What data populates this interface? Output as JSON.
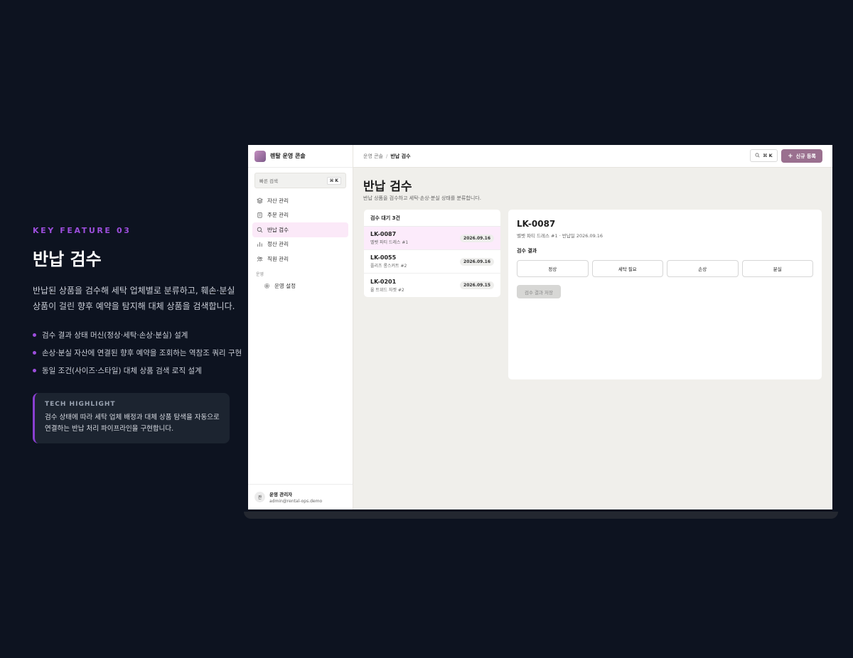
{
  "feature": {
    "eyebrow": "KEY FEATURE 03",
    "title": "반납 검수",
    "description": "반납된 상품을 검수해 세탁 업체별로 분류하고, 훼손·분실 상품이 걸린 향후 예약을 탐지해 대체 상품을 검색합니다.",
    "bullets": [
      "검수 결과 상태 머신(정상·세탁·손상·분실) 설계",
      "손상·분실 자산에 연결된 향후 예약을 조회하는 역참조 쿼리 구현",
      "동일 조건(사이즈·스타일) 대체 상품 검색 로직 설계"
    ],
    "tech_label": "TECH HIGHLIGHT",
    "tech_text": "검수 상태에 따라 세탁 업체 배정과 대체 상품 탐색을 자동으로 연결하는 반납 처리 파이프라인을 구현합니다.",
    "accent_color": "#9d4edd"
  },
  "app": {
    "brand": "렌탈 운영 콘솔",
    "quick_search_label": "빠른 검색",
    "quick_search_shortcut": "⌘ K",
    "nav": [
      {
        "label": "자산 관리",
        "icon": "layers-icon",
        "active": false
      },
      {
        "label": "주문 관리",
        "icon": "clipboard-icon",
        "active": false
      },
      {
        "label": "반납 검수",
        "icon": "search-icon",
        "active": true
      },
      {
        "label": "정산 관리",
        "icon": "bar-chart-icon",
        "active": false
      },
      {
        "label": "직원 관리",
        "icon": "users-icon",
        "active": false
      }
    ],
    "nav_section": "운영",
    "settings_label": "운영 설정",
    "user": {
      "avatar": "관",
      "name": "운영 관리자",
      "email": "admin@rental-ops.demo"
    },
    "breadcrumb": {
      "root": "운영 콘솔",
      "separator": "/",
      "current": "반납 검수"
    },
    "top_search_shortcut": "⌘ K",
    "new_button": "신규 등록",
    "page_title": "반납 검수",
    "page_subtitle": "반납 상품을 검수하고 세탁·손상·분실 상태를 분류합니다.",
    "queue": {
      "header": "검수 대기 3건",
      "rows": [
        {
          "code": "LK-0087",
          "name": "벨벳 파티 드레스 #1",
          "date": "2026.09.16",
          "selected": true
        },
        {
          "code": "LK-0055",
          "name": "플리츠 롱스커트 #2",
          "date": "2026.09.16",
          "selected": false
        },
        {
          "code": "LK-0201",
          "name": "울 트위드 자켓 #2",
          "date": "2026.09.15",
          "selected": false
        }
      ]
    },
    "detail": {
      "code": "LK-0087",
      "meta": "벨벳 파티 드레스 #1 · 반납일 2026.09.16",
      "result_label": "검수 결과",
      "results": [
        "정상",
        "세탁 필요",
        "손상",
        "분실"
      ],
      "save_label": "검수 결과 저장"
    },
    "colors": {
      "primary_button": "#9a708f",
      "active_nav": "#fbe9f8"
    }
  }
}
